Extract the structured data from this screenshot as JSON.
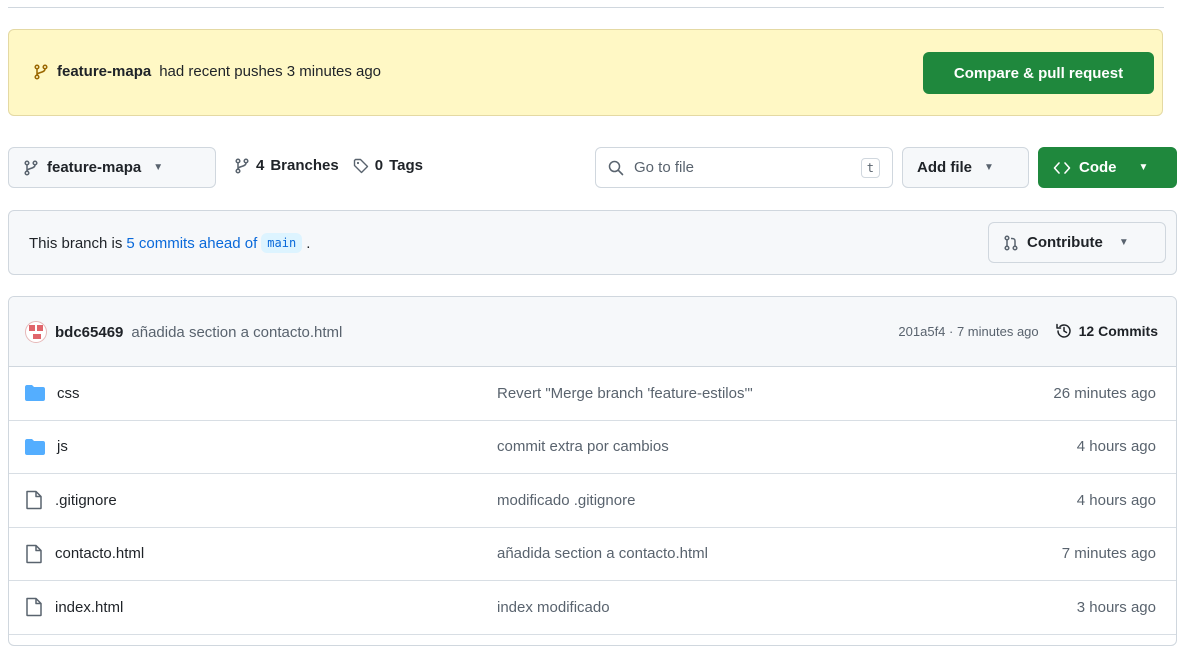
{
  "banner": {
    "branch": "feature-mapa",
    "text": "had recent pushes 3 minutes ago",
    "button": "Compare & pull request"
  },
  "toolbar": {
    "branch_select": "feature-mapa",
    "branches_count": "4",
    "branches_label": "Branches",
    "tags_count": "0",
    "tags_label": "Tags",
    "search_placeholder": "Go to file",
    "search_shortcut": "t",
    "add_file": "Add file",
    "code": "Code"
  },
  "ahead": {
    "prefix": "This branch is",
    "link": "5 commits ahead of",
    "base": "main",
    "suffix": ".",
    "contribute": "Contribute"
  },
  "latest_commit": {
    "author": "bdc65469",
    "message": "añadida section a contacto.html",
    "meta": "201a5f4 · 7 minutes ago",
    "commits": "12 Commits"
  },
  "files": [
    {
      "name": "css",
      "type": "folder",
      "message": "Revert \"Merge branch 'feature-estilos'\"",
      "time": "26 minutes ago"
    },
    {
      "name": "js",
      "type": "folder",
      "message": "commit extra por cambios",
      "time": "4 hours ago"
    },
    {
      "name": ".gitignore",
      "type": "file",
      "message": "modificado .gitignore",
      "time": "4 hours ago"
    },
    {
      "name": "contacto.html",
      "type": "file",
      "message": "añadida section a contacto.html",
      "time": "7 minutes ago"
    },
    {
      "name": "index.html",
      "type": "file",
      "message": "index modificado",
      "time": "3 hours ago"
    }
  ],
  "colors": {
    "primary_green": "#1f883d",
    "banner_bg": "#fff8c5",
    "link_blue": "#0969da",
    "folder_blue": "#54aeff"
  }
}
